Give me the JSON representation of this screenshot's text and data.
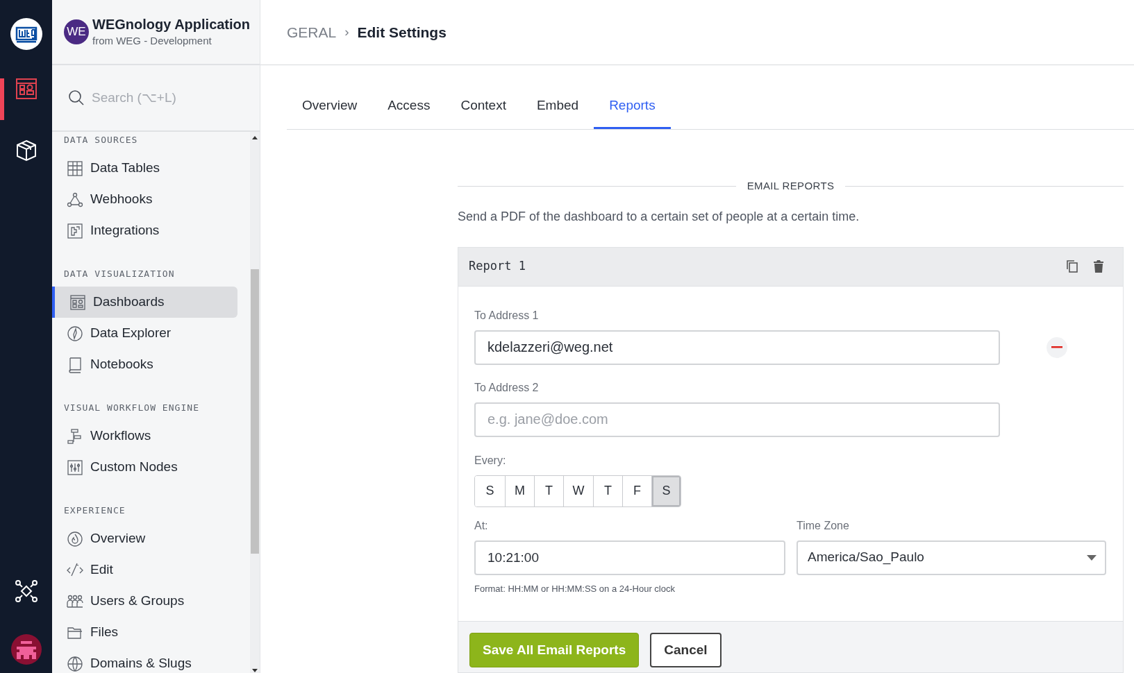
{
  "app": {
    "badge": "WE",
    "title": "WEGnology Application",
    "subtitle": "from WEG - Development"
  },
  "search": {
    "placeholder": "Search (⌥+L)"
  },
  "sidebar": {
    "sections": [
      {
        "title": "DATA SOURCES",
        "items": [
          {
            "label": "Data Tables",
            "selected": false
          },
          {
            "label": "Webhooks",
            "selected": false
          },
          {
            "label": "Integrations",
            "selected": false
          }
        ]
      },
      {
        "title": "DATA VISUALIZATION",
        "items": [
          {
            "label": "Dashboards",
            "selected": true
          },
          {
            "label": "Data Explorer",
            "selected": false
          },
          {
            "label": "Notebooks",
            "selected": false
          }
        ]
      },
      {
        "title": "VISUAL WORKFLOW ENGINE",
        "items": [
          {
            "label": "Workflows",
            "selected": false
          },
          {
            "label": "Custom Nodes",
            "selected": false
          }
        ]
      },
      {
        "title": "EXPERIENCE",
        "items": [
          {
            "label": "Overview",
            "selected": false
          },
          {
            "label": "Edit",
            "selected": false
          },
          {
            "label": "Users & Groups",
            "selected": false
          },
          {
            "label": "Files",
            "selected": false
          },
          {
            "label": "Domains & Slugs",
            "selected": false
          }
        ]
      }
    ]
  },
  "breadcrumb": {
    "parent": "GERAL",
    "separator": "›",
    "current": "Edit Settings"
  },
  "tabs": [
    {
      "label": "Overview",
      "selected": false
    },
    {
      "label": "Access",
      "selected": false
    },
    {
      "label": "Context",
      "selected": false
    },
    {
      "label": "Embed",
      "selected": false
    },
    {
      "label": "Reports",
      "selected": true
    }
  ],
  "section": {
    "title": "EMAIL REPORTS",
    "description": "Send a PDF of the dashboard to a certain set of people at a certain time."
  },
  "report": {
    "title": "Report 1",
    "addresses": [
      {
        "label": "To Address 1",
        "value": "kdelazzeri@weg.net",
        "removable": true
      },
      {
        "label": "To Address 2",
        "placeholder": "e.g. jane@doe.com",
        "removable": false
      }
    ],
    "every_label": "Every:",
    "days": [
      {
        "label": "S",
        "selected": false
      },
      {
        "label": "M",
        "selected": false
      },
      {
        "label": "T",
        "selected": false
      },
      {
        "label": "W",
        "selected": false
      },
      {
        "label": "T",
        "selected": false
      },
      {
        "label": "F",
        "selected": false
      },
      {
        "label": "S",
        "selected": true
      }
    ],
    "at_label": "At:",
    "at_value": "10:21:00",
    "hint": "Format: HH:MM or HH:MM:SS on a 24-Hour clock",
    "timezone_label": "Time Zone",
    "timezone_value": "America/Sao_Paulo"
  },
  "buttons": {
    "save": "Save All Email Reports",
    "cancel": "Cancel"
  }
}
